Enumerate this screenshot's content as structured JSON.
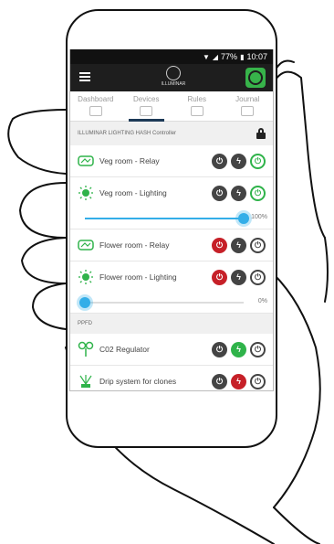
{
  "status_bar": {
    "battery": "77%",
    "time": "10:07"
  },
  "app_bar": {
    "logo_text": "ILLUMINAR"
  },
  "tabs": [
    {
      "label": "Dashboard",
      "active": false
    },
    {
      "label": "Devices",
      "active": true
    },
    {
      "label": "Rules",
      "active": false
    },
    {
      "label": "Journal",
      "active": false
    }
  ],
  "controller": {
    "title": "ILLUMINAR LIGHTING HASH Controller"
  },
  "devices": [
    {
      "label": "Veg room - Relay",
      "icon": "relay-icon",
      "buttons": [
        "grey",
        "grey",
        "green-ring"
      ]
    },
    {
      "label": "Veg room - Lighting",
      "icon": "sun-icon",
      "buttons": [
        "grey",
        "grey",
        "green-ring"
      ],
      "level_text": "100%",
      "level": 1.0
    },
    {
      "label": "Flower room - Relay",
      "icon": "relay-icon",
      "buttons": [
        "red",
        "grey",
        "grey-ring"
      ]
    },
    {
      "label": "Flower room - Lighting",
      "icon": "sun-icon",
      "buttons": [
        "red",
        "grey",
        "grey-ring"
      ],
      "level_text": "0%",
      "level": 0.0
    }
  ],
  "ppfd": {
    "title": "PPFD"
  },
  "ppfd_devices": [
    {
      "label": "C02 Regulator",
      "icon": "co2-icon",
      "buttons": [
        "grey",
        "green",
        "grey-ring"
      ]
    },
    {
      "label": "Drip system for clones",
      "icon": "drip-icon",
      "buttons": [
        "grey",
        "red",
        "grey-ring"
      ]
    },
    {
      "label": "",
      "icon": "fan-icon",
      "buttons": [
        "grey",
        "red",
        "grey-ring"
      ]
    }
  ],
  "colors": {
    "accent": "#33aee8",
    "green": "#2fb34a",
    "red": "#c62028",
    "appbar": "#1e1e1e"
  }
}
